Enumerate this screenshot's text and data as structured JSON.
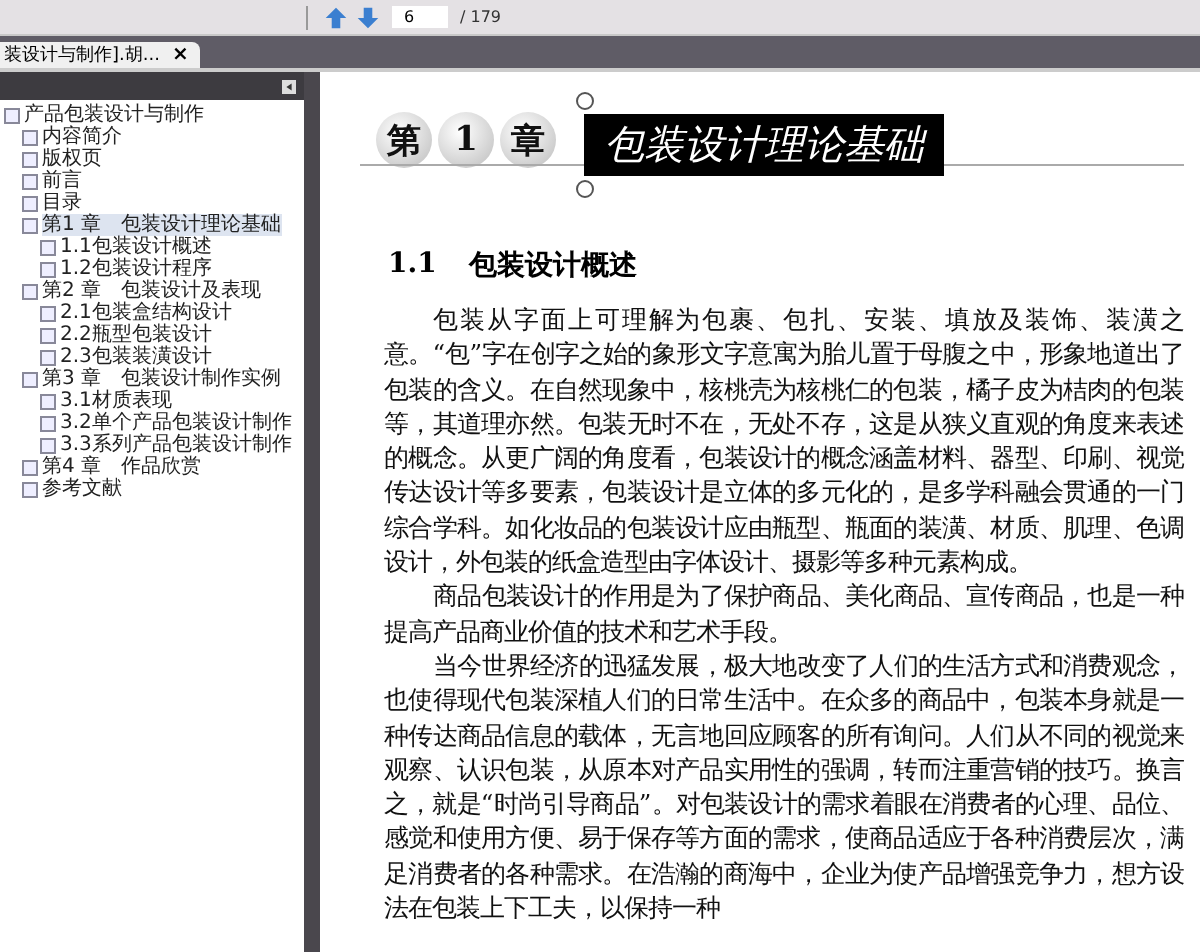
{
  "toolbar": {
    "page_field": "6",
    "page_total": "/ 179"
  },
  "tabs": [
    {
      "label": "装设计与制作].胡...",
      "selected": true,
      "close": "×"
    }
  ],
  "outline": {
    "items": [
      {
        "label": "产品包装设计与制作",
        "selected": false,
        "expanded": true,
        "children": [
          {
            "label": "内容简介",
            "selected": false
          },
          {
            "label": "版权页",
            "selected": false
          },
          {
            "label": "前言",
            "selected": false
          },
          {
            "label": "目录",
            "selected": false
          },
          {
            "label": "第1 章　包装设计理论基础",
            "selected": true,
            "expanded": true,
            "children": [
              {
                "label": "1.1包装设计概述",
                "selected": false
              },
              {
                "label": "1.2包装设计程序",
                "selected": false
              }
            ]
          },
          {
            "label": "第2 章　包装设计及表现",
            "selected": false,
            "expanded": true,
            "children": [
              {
                "label": "2.1包装盒结构设计",
                "selected": false
              },
              {
                "label": "2.2瓶型包装设计",
                "selected": false
              },
              {
                "label": "2.3包装装潢设计",
                "selected": false
              }
            ]
          },
          {
            "label": "第3 章　包装设计制作实例",
            "selected": false,
            "expanded": true,
            "children": [
              {
                "label": "3.1材质表现",
                "selected": false
              },
              {
                "label": "3.2单个产品包装设计制作",
                "selected": false
              },
              {
                "label": "3.3系列产品包装设计制作",
                "selected": false
              }
            ]
          },
          {
            "label": "第4 章　作品欣赏",
            "selected": false
          },
          {
            "label": "参考文献",
            "selected": false
          }
        ]
      }
    ]
  },
  "page": {
    "chapter_badges": [
      "第",
      "1",
      "章"
    ],
    "chapter_title": "包装设计理论基础",
    "section_number": "1.1",
    "section_title": "包装设计概述",
    "paragraphs": [
      "包装从字面上可理解为包裹、包扎、安装、填放及装饰、装潢之意。“包”字在创字之始的象形文字意寓为胎儿置于母腹之中，形象地道出了包装的含义。在自然现象中，核桃壳为核桃仁的包装，橘子皮为桔肉的包装等，其道理亦然。包装无时不在，无处不存，这是从狭义直观的角度来表述的概念。从更广阔的角度看，包装设计的概念涵盖材料、器型、印刷、视觉传达设计等多要素，包装设计是立体的多元化的，是多学科融会贯通的一门综合学科。如化妆品的包装设计应由瓶型、瓶面的装潢、材质、肌理、色调设计，外包装的纸盒造型由字体设计、摄影等多种元素构成。",
      "商品包装设计的作用是为了保护商品、美化商品、宣传商品，也是一种提高产品商业价值的技术和艺术手段。",
      "当今世界经济的迅猛发展，极大地改变了人们的生活方式和消费观念，也使得现代包装深植人们的日常生活中。在众多的商品中，包装本身就是一种传达商品信息的载体，无言地回应顾客的所有询问。人们从不同的视觉来观察、认识包装，从原本对产品实用性的强调，转而注重营销的技巧。换言之，就是“时尚引导商品”。对包装设计的需求着眼在消费者的心理、品位、感觉和使用方便、易于保存等方面的需求，使商品适应于各种消费层次，满足消费者的各种需求。在浩瀚的商海中，企业为使产品增强竞争力，想方设法在包装上下工夫，以保持一种"
    ]
  }
}
